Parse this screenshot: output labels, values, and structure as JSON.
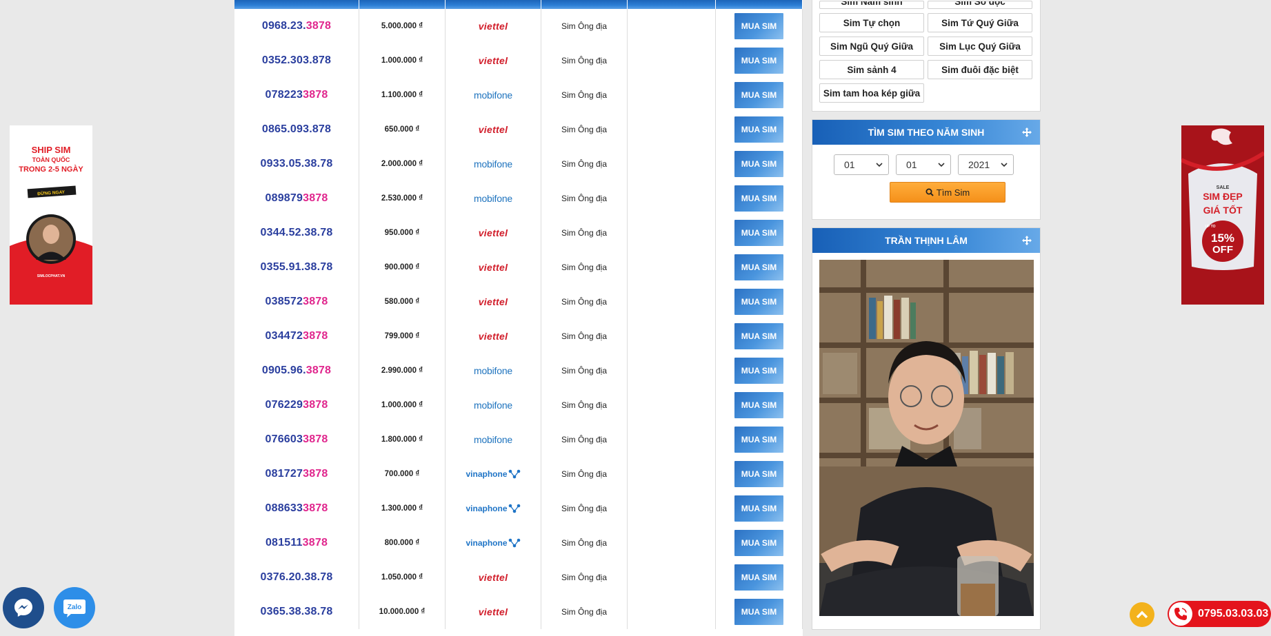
{
  "table": {
    "rows": [
      {
        "num_head": "0968.23.",
        "num_tail": "3878",
        "price": "5.000.000 ₫",
        "network": "viettel",
        "type": "Sim Ông địa",
        "buy": "MUA SIM"
      },
      {
        "num_head": "0352.303.878",
        "num_tail": "",
        "price": "1.000.000 ₫",
        "network": "viettel",
        "type": "Sim Ông địa",
        "buy": "MUA SIM"
      },
      {
        "num_head": "078223",
        "num_tail": "3878",
        "price": "1.100.000 ₫",
        "network": "mobifone",
        "type": "Sim Ông địa",
        "buy": "MUA SIM"
      },
      {
        "num_head": "0865.093.878",
        "num_tail": "",
        "price": "650.000 ₫",
        "network": "viettel",
        "type": "Sim Ông địa",
        "buy": "MUA SIM"
      },
      {
        "num_head": "0933.05.38.78",
        "num_tail": "",
        "price": "2.000.000 ₫",
        "network": "mobifone",
        "type": "Sim Ông địa",
        "buy": "MUA SIM"
      },
      {
        "num_head": "089879",
        "num_tail": "3878",
        "price": "2.530.000 ₫",
        "network": "mobifone",
        "type": "Sim Ông địa",
        "buy": "MUA SIM"
      },
      {
        "num_head": "0344.52.38.78",
        "num_tail": "",
        "price": "950.000 ₫",
        "network": "viettel",
        "type": "Sim Ông địa",
        "buy": "MUA SIM"
      },
      {
        "num_head": "0355.91.38.78",
        "num_tail": "",
        "price": "900.000 ₫",
        "network": "viettel",
        "type": "Sim Ông địa",
        "buy": "MUA SIM"
      },
      {
        "num_head": "038572",
        "num_tail": "3878",
        "price": "580.000 ₫",
        "network": "viettel",
        "type": "Sim Ông địa",
        "buy": "MUA SIM"
      },
      {
        "num_head": "034472",
        "num_tail": "3878",
        "price": "799.000 ₫",
        "network": "viettel",
        "type": "Sim Ông địa",
        "buy": "MUA SIM"
      },
      {
        "num_head": "0905.96.",
        "num_tail": "3878",
        "price": "2.990.000 ₫",
        "network": "mobifone",
        "type": "Sim Ông địa",
        "buy": "MUA SIM"
      },
      {
        "num_head": "076229",
        "num_tail": "3878",
        "price": "1.000.000 ₫",
        "network": "mobifone",
        "type": "Sim Ông địa",
        "buy": "MUA SIM"
      },
      {
        "num_head": "076603",
        "num_tail": "3878",
        "price": "1.800.000 ₫",
        "network": "mobifone",
        "type": "Sim Ông địa",
        "buy": "MUA SIM"
      },
      {
        "num_head": "081727",
        "num_tail": "3878",
        "price": "700.000 ₫",
        "network": "vinaphone",
        "type": "Sim Ông địa",
        "buy": "MUA SIM"
      },
      {
        "num_head": "088633",
        "num_tail": "3878",
        "price": "1.300.000 ₫",
        "network": "vinaphone",
        "type": "Sim Ông địa",
        "buy": "MUA SIM"
      },
      {
        "num_head": "081511",
        "num_tail": "3878",
        "price": "800.000 ₫",
        "network": "vinaphone",
        "type": "Sim Ông địa",
        "buy": "MUA SIM"
      },
      {
        "num_head": "0376.20.38.78",
        "num_tail": "",
        "price": "1.050.000 ₫",
        "network": "viettel",
        "type": "Sim Ông địa",
        "buy": "MUA SIM"
      },
      {
        "num_head": "0365.38.38.78",
        "num_tail": "",
        "price": "10.000.000 ₫",
        "network": "viettel",
        "type": "Sim Ông địa",
        "buy": "MUA SIM"
      }
    ]
  },
  "sidebar": {
    "categories_partial": [
      "Sim Năm sinh",
      "Sim Số độc"
    ],
    "categories": [
      "Sim Tự chọn",
      "Sim Tứ Quý Giữa",
      "Sim Ngũ Quý Giữa",
      "Sim Lục Quý Giữa",
      "Sim sảnh 4",
      "Sim đuôi đặc biệt",
      "Sim tam hoa kép giữa"
    ],
    "year_title": "TÌM SIM THEO NĂM SINH",
    "day": "01",
    "month": "01",
    "year": "2021",
    "find_label": "Tìm Sim",
    "person_title": "TRẦN THỊNH LÂM"
  },
  "ads": {
    "left": {
      "line1": "SHIP SIM",
      "line2": "TOÀN QUỐC",
      "line3": "TRONG 2-5 NGÀY",
      "badge": "ĐỪNG NGAY",
      "footer": "SIMLOCPHAT.VN"
    },
    "right": {
      "sale": "SALE",
      "l1": "SIM ĐẸP",
      "l2": "GIÁ TỐT",
      "upto": "UP TO",
      "pct": "15%",
      "off": "OFF"
    }
  },
  "logos": {
    "viettel": "viettel",
    "mobifone": "mobifone",
    "vinaphone": "vinaphone"
  },
  "phone": "0795.03.03.03",
  "zalo": "Zalo",
  "colors": {
    "accent": "#1c64b8",
    "number": "#2a3e9e",
    "highlight": "#e0268d",
    "phone": "#e4141c"
  }
}
